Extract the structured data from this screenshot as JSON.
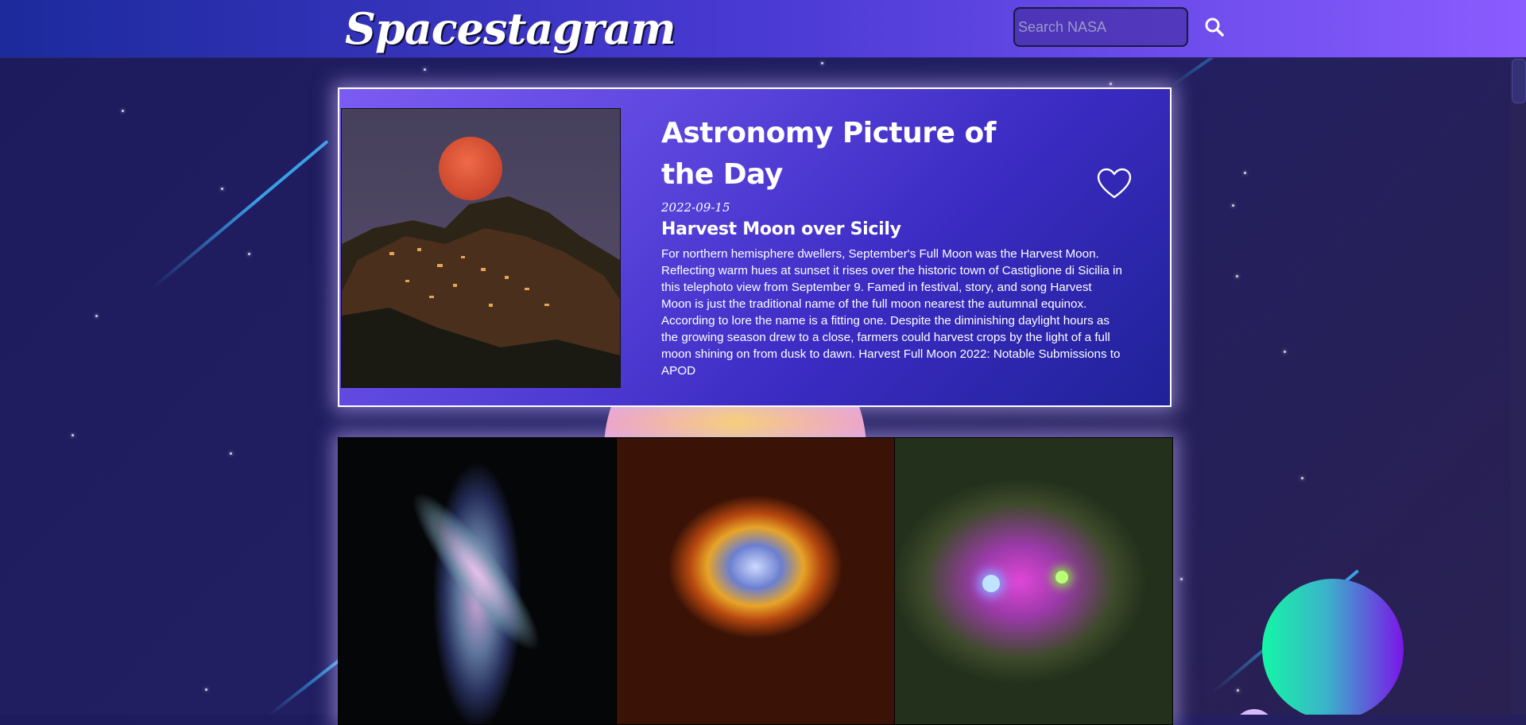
{
  "app": {
    "logo": "Spacestagram"
  },
  "search": {
    "placeholder": "Search NASA",
    "value": "",
    "icon": "search-icon"
  },
  "apod": {
    "heading": "Astronomy Picture of the Day",
    "date": "2022-09-15",
    "title": "Harvest Moon over Sicily",
    "description": "For northern hemisphere dwellers, September's Full Moon was the Harvest Moon. Reflecting warm hues at sunset it rises over the historic town of Castiglione di Sicilia in this telephoto view from September 9. Famed in festival, story, and song Harvest Moon is just the traditional name of the full moon nearest the autumnal equinox. According to lore the name is a fitting one. Despite the diminishing daylight hours as the growing season drew to a close, farmers could harvest crops by the light of a full moon shining on from dusk to dawn. Harvest Full Moon 2022: Notable Submissions to APOD",
    "like_icon": "heart-outline-icon",
    "image_subject": "full-moon-over-hill-town"
  },
  "gallery": [
    {
      "subject": "spiral-galaxy-edge-on"
    },
    {
      "subject": "nebula-bubble"
    },
    {
      "subject": "galaxy-cluster"
    }
  ],
  "colors": {
    "header_start": "#1c2a9c",
    "header_end": "#8b5cff",
    "background": "#1d1a5e",
    "card_start": "#7c5cf2",
    "card_end": "#1f2298",
    "streak": "#3aa0e6",
    "planet_start": "#14f7a6",
    "planet_end": "#7a16e8"
  }
}
